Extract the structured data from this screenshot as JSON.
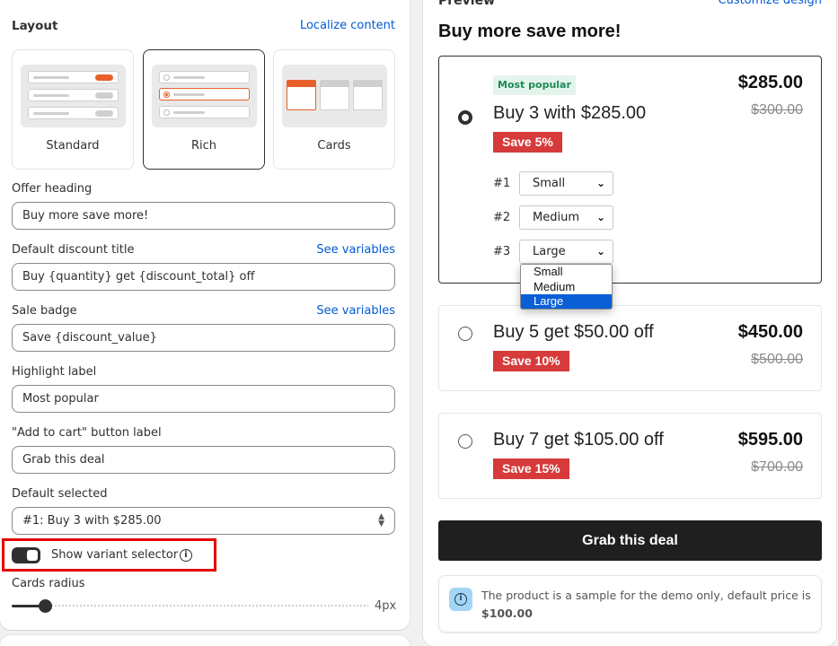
{
  "settings": {
    "layout_label": "Layout",
    "localize_link": "Localize content",
    "layout_options": [
      {
        "label": "Standard",
        "selected": false
      },
      {
        "label": "Rich",
        "selected": true
      },
      {
        "label": "Cards",
        "selected": false
      }
    ],
    "offer_heading": {
      "label": "Offer heading",
      "value": "Buy more save more!"
    },
    "default_discount_title": {
      "label": "Default discount title",
      "link": "See variables",
      "value": "Buy {quantity} get {discount_total} off"
    },
    "sale_badge": {
      "label": "Sale badge",
      "link": "See variables",
      "value": "Save {discount_value}"
    },
    "highlight_label": {
      "label": "Highlight label",
      "value": "Most popular"
    },
    "add_to_cart_label": {
      "label": "\"Add to cart\" button label",
      "value": "Grab this deal"
    },
    "default_selected": {
      "label": "Default selected",
      "value": "#1: Buy 3 with $285.00"
    },
    "show_variant_selector": {
      "label": "Show variant selector",
      "on": true
    },
    "cards_radius": {
      "label": "Cards radius",
      "value": "4px",
      "level": 0.09
    }
  },
  "preview": {
    "header_label": "Preview",
    "customize_link": "Customize design",
    "heading": "Buy more save more!",
    "offers": [
      {
        "title": "Buy 3 with $285.00",
        "badge": "Most popular",
        "save": "Save 5%",
        "price": "$285.00",
        "old_price": "$300.00",
        "selected": true,
        "variants": [
          {
            "num": "#1",
            "value": "Small"
          },
          {
            "num": "#2",
            "value": "Medium"
          },
          {
            "num": "#3",
            "value": "Large"
          }
        ]
      },
      {
        "title": "Buy 5 get $50.00 off",
        "save": "Save 10%",
        "price": "$450.00",
        "old_price": "$500.00",
        "selected": false
      },
      {
        "title": "Buy 7 get $105.00 off",
        "save": "Save 15%",
        "price": "$595.00",
        "old_price": "$700.00",
        "selected": false
      }
    ],
    "dropdown_options": [
      "Small",
      "Medium",
      "Large"
    ],
    "dropdown_active": "Large",
    "cta_label": "Grab this deal",
    "notice_text": "The product is a sample for the demo only, default price is",
    "notice_price": "$100.00"
  },
  "colors": {
    "accent_orange": "#e8612c",
    "save_red": "#d63a3a",
    "link_blue": "#005bd3",
    "highlight_box": "#e60000"
  }
}
